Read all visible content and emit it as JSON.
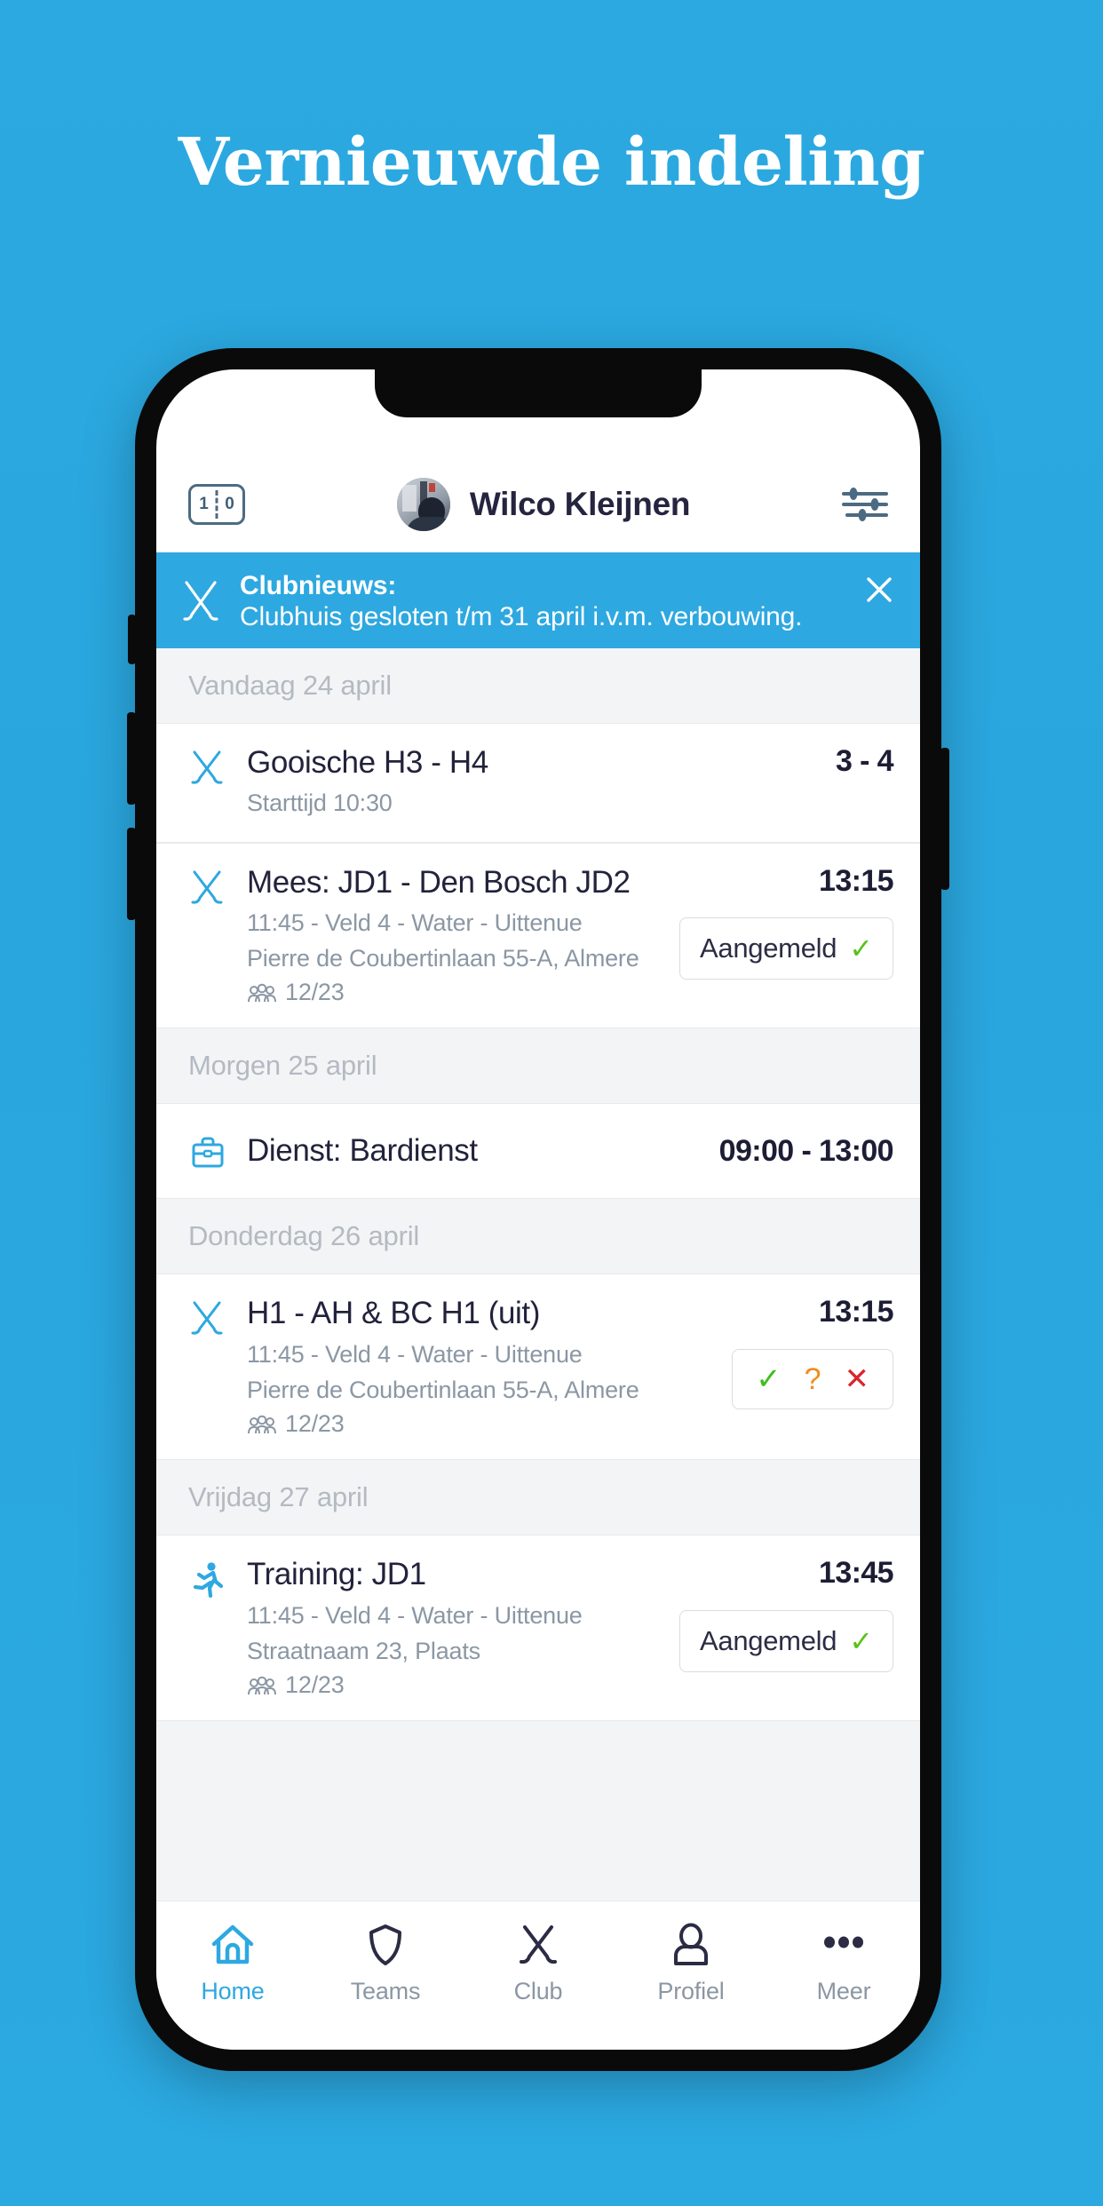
{
  "promo": {
    "title": "Vernieuwde indeling",
    "background_color": "#29a9e1",
    "title_color": "#ffffff"
  },
  "app": {
    "accent_color": "#2ea8e0",
    "header": {
      "score_icon": "scoreboard-icon",
      "score_left": "1",
      "score_right": "0",
      "user_name": "Wilco Kleijnen",
      "avatar": "user-avatar",
      "filter_icon": "sliders-icon"
    },
    "banner": {
      "icon": "hockey-sticks-icon",
      "title": "Clubnieuws:",
      "body": "Clubhuis gesloten t/m 31 april i.v.m. verbouwing.",
      "close_icon": "close-icon",
      "background_color": "#2ea8e0"
    },
    "agenda": [
      {
        "day_label": "Vandaag 24 april",
        "events": [
          {
            "icon": "hockey-sticks-icon",
            "title": "Gooische H3 - H4",
            "subtitle_1": "Starttijd 10:30",
            "subtitle_2": null,
            "attendance": null,
            "right_value": "3 - 4",
            "action": null
          }
        ]
      },
      {
        "day_label": null,
        "events": [
          {
            "icon": "hockey-sticks-icon",
            "title": "Mees: JD1 - Den Bosch JD2",
            "subtitle_1": "11:45 - Veld 4 - Water - Uittenue",
            "subtitle_2": "Pierre de Coubertinlaan 55-A, Almere",
            "attendance": "12/23",
            "right_value": "13:15",
            "action": {
              "type": "signed-up",
              "label": "Aangemeld",
              "tick": "✓"
            }
          }
        ]
      },
      {
        "day_label": "Morgen 25 april",
        "events": [
          {
            "icon": "briefcase-icon",
            "title": "Dienst: Bardienst",
            "subtitle_1": null,
            "subtitle_2": null,
            "attendance": null,
            "right_value": "09:00 - 13:00",
            "action": null
          }
        ]
      },
      {
        "day_label": "Donderdag 26 april",
        "events": [
          {
            "icon": "hockey-sticks-icon",
            "title": "H1 - AH & BC H1 (uit)",
            "subtitle_1": "11:45 - Veld 4 - Water - Uittenue",
            "subtitle_2": "Pierre de Coubertinlaan 55-A, Almere",
            "attendance": "12/23",
            "right_value": "13:15",
            "action": {
              "type": "respond",
              "yes": "✓",
              "maybe": "?",
              "no": "✕",
              "yes_color": "#3fbf1e",
              "maybe_color": "#f08b1d",
              "no_color": "#d8262c"
            }
          }
        ]
      },
      {
        "day_label": "Vrijdag 27 april",
        "events": [
          {
            "icon": "running-icon",
            "title": "Training: JD1",
            "subtitle_1": "11:45 - Veld 4 - Water - Uittenue",
            "subtitle_2": "Straatnaam 23, Plaats",
            "attendance": "12/23",
            "right_value": "13:45",
            "action": {
              "type": "signed-up",
              "label": "Aangemeld",
              "tick": "✓"
            }
          }
        ]
      }
    ],
    "bottom_nav": {
      "active": "Home",
      "items": [
        {
          "label": "Home",
          "icon": "home-icon"
        },
        {
          "label": "Teams",
          "icon": "shield-icon"
        },
        {
          "label": "Club",
          "icon": "hockey-sticks-icon"
        },
        {
          "label": "Profiel",
          "icon": "person-icon"
        },
        {
          "label": "Meer",
          "icon": "ellipsis-icon"
        }
      ]
    }
  }
}
